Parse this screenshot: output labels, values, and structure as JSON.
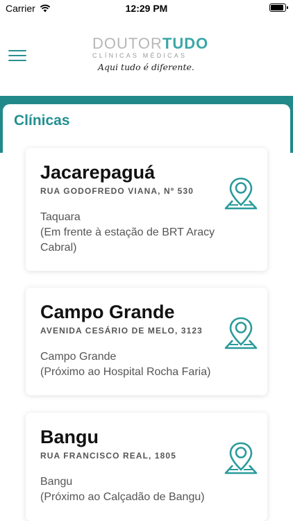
{
  "status_bar": {
    "carrier": "Carrier",
    "time": "12:29 PM",
    "battery_level": 0.9
  },
  "header": {
    "menu_icon": "hamburger-menu-icon",
    "logo": {
      "part1": "DOUTOR",
      "part2": "TUDO",
      "subtitle": "CLÍNICAS MÉDICAS",
      "tagline": "Aqui tudo é diferente."
    }
  },
  "colors": {
    "accent": "#21898a",
    "title": "#238f91",
    "logo_gray": "#b7b7b7"
  },
  "section": {
    "title": "Clínicas"
  },
  "clinics": [
    {
      "name": "Jacarepaguá",
      "address": "RUA GODOFREDO VIANA, Nº 530",
      "neighborhood": "Taquara",
      "note": "(Em frente à estação de BRT Aracy Cabral)",
      "icon": "map-pin-icon"
    },
    {
      "name": "Campo Grande",
      "address": "AVENIDA CESÁRIO DE MELO, 3123",
      "neighborhood": "Campo Grande",
      "note": "(Próximo ao Hospital Rocha Faria)",
      "icon": "map-pin-icon"
    },
    {
      "name": "Bangu",
      "address": "RUA FRANCISCO REAL, 1805",
      "neighborhood": "Bangu",
      "note": "(Próximo ao Calçadão de Bangu)",
      "icon": "map-pin-icon"
    }
  ]
}
